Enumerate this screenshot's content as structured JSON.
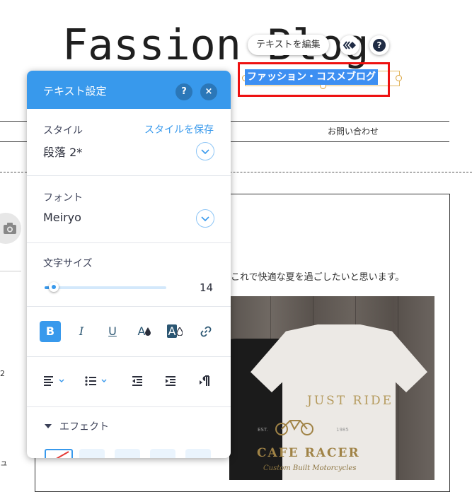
{
  "canvas": {
    "blog_title": "Fassion Blog",
    "selected_text": "ファッション・コスメブログ",
    "menu_contact": "お問い合わせ",
    "post_text": "これで快適な夏を過ごしたいと思います。",
    "photo_print": {
      "top": "JUST RIDE",
      "main": "CAFE RACER",
      "sub": "Custom Built Motorcycles",
      "years_left": "EST.",
      "years_right": "1985"
    },
    "left_glyph_1": "2",
    "left_glyph_2": "ュ"
  },
  "context_toolbar": {
    "edit_text_label": "テキストを編集",
    "help_label": "?"
  },
  "text_panel": {
    "title": "テキスト設定",
    "help_label": "?",
    "close_label": "×",
    "style": {
      "label": "スタイル",
      "save_link": "スタイルを保存",
      "value": "段落 2*"
    },
    "font": {
      "label": "フォント",
      "value": "Meiryo"
    },
    "size": {
      "label": "文字サイズ",
      "value": "14",
      "slider_fraction": 0.04
    },
    "format_buttons": {
      "bold": "B",
      "italic": "I",
      "underline": "U",
      "color": "A",
      "highlight": "A",
      "link": "link"
    },
    "effect_label": "エフェクト"
  },
  "colors": {
    "accent": "#3899ec",
    "selection_highlight": "#3d8ff2",
    "annotation_box": "#ee1111"
  }
}
